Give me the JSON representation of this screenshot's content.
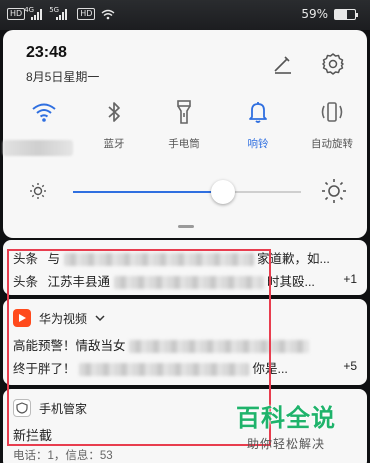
{
  "status_bar": {
    "left_chips": [
      "HD",
      "4G",
      "5G",
      "HD"
    ],
    "battery": "59%",
    "battery_level": 0.59
  },
  "quick_settings": {
    "time": "23:48",
    "date": "8月5日星期一",
    "tiles": [
      {
        "label": "",
        "icon": "wifi-icon",
        "active": true
      },
      {
        "label": "蓝牙",
        "icon": "bluetooth-icon",
        "active": false
      },
      {
        "label": "手电筒",
        "icon": "flashlight-icon",
        "active": false
      },
      {
        "label": "响铃",
        "icon": "bell-icon",
        "active": true
      },
      {
        "label": "自动旋转",
        "icon": "rotate-icon",
        "active": false
      }
    ],
    "brightness_level": 0.66,
    "accent_color": "#2f6fe0"
  },
  "notifications": {
    "toutiao": {
      "rows": [
        {
          "prefix": "头条",
          "text_start": "与",
          "text_end": "家道歉，如..."
        },
        {
          "prefix": "头条",
          "text_start": "江苏丰县通",
          "text_end": "时其殴..."
        }
      ],
      "count": "+1"
    },
    "huawei_video": {
      "app_name": "华为视频",
      "rows": [
        {
          "text_start": "高能预警！情敌当女",
          "text_end": ""
        },
        {
          "text_start": "终于胖了！",
          "text_end": "你是..."
        }
      ],
      "count": "+5"
    },
    "phone_manager": {
      "app_name": "手机管家",
      "title": "新拦截",
      "detail": "电话：1，信息：53"
    }
  },
  "watermark": {
    "title": "百科全说",
    "subtitle": "助你轻松解决",
    "color": "#1fb36b"
  },
  "highlight_color": "#e83d4e"
}
